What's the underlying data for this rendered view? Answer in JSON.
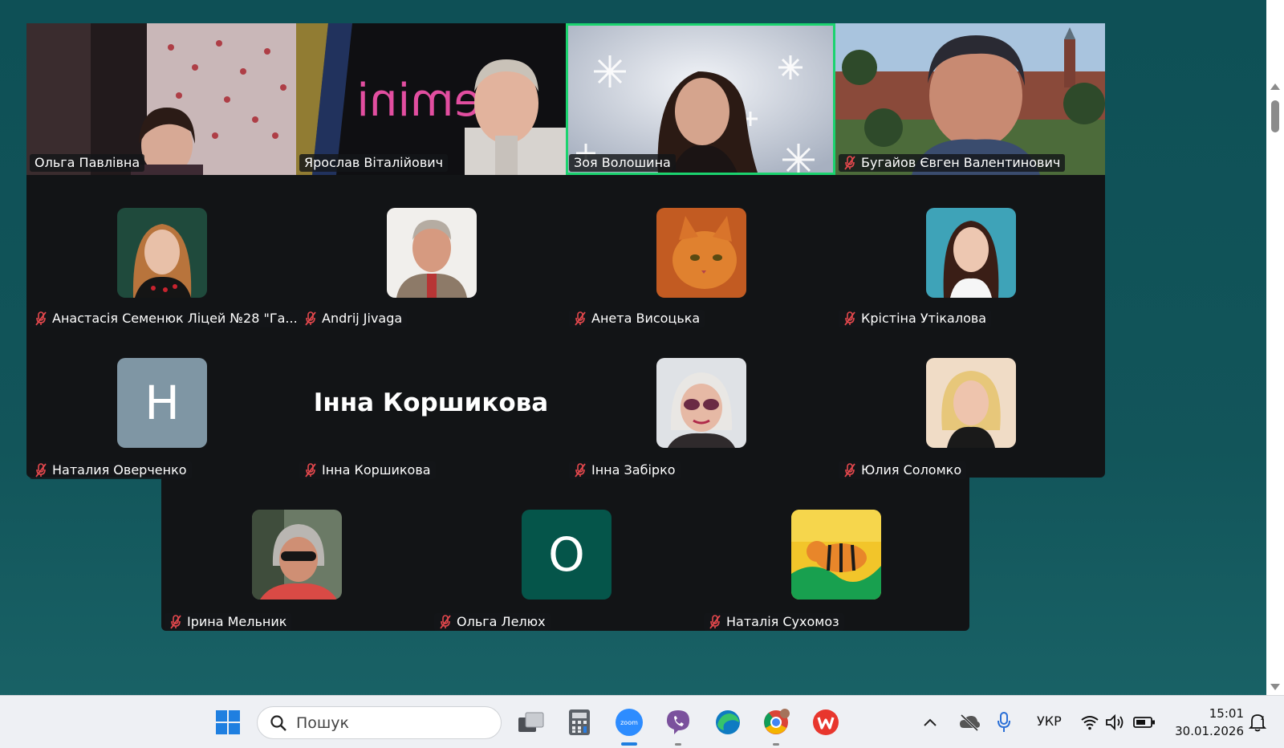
{
  "video_tiles": [
    {
      "name": "Ольга Павлівна",
      "muted": false
    },
    {
      "name": "Ярослав Віталійович",
      "muted": false,
      "logo_text": "Gemini"
    },
    {
      "name": "Зоя Волошина",
      "muted": false,
      "active_speaker": true
    },
    {
      "name": "Бугайов Євген Валентинович",
      "muted": true
    }
  ],
  "row2": [
    {
      "name": "Анастасія Семенюк Ліцей №28 \"Га...",
      "muted": true
    },
    {
      "name": "Andrij Jivaga",
      "muted": true
    },
    {
      "name": "Анета Висоцька",
      "muted": true
    },
    {
      "name": "Крістіна Утікалова",
      "muted": true
    }
  ],
  "row3": [
    {
      "name": "Наталия Оверченко",
      "muted": true,
      "avatar_letter": "Н"
    },
    {
      "name": "Інна Коршикова",
      "muted": true,
      "display_name": "Інна Коршикова"
    },
    {
      "name": "Інна Забірко",
      "muted": true
    },
    {
      "name": "Юлия Соломко",
      "muted": true
    }
  ],
  "row4": [
    {
      "name": "Ірина Мельник",
      "muted": true
    },
    {
      "name": "Ольга Лелюх",
      "muted": true,
      "avatar_letter": "О"
    },
    {
      "name": "Наталія Сухомоз",
      "muted": true
    }
  ],
  "taskbar": {
    "search_placeholder": "Пошук",
    "apps": [
      "start-icon",
      "task-view-icon",
      "calculator-icon",
      "zoom-icon",
      "viber-icon",
      "edge-icon",
      "chrome-icon",
      "wps-icon"
    ],
    "language": "УКР",
    "time": "15:01",
    "date": "30.01.2026"
  },
  "colors": {
    "active_speaker_border": "#1bd36f",
    "mute_icon": "#e5484d",
    "gallery_bg": "#121416"
  }
}
